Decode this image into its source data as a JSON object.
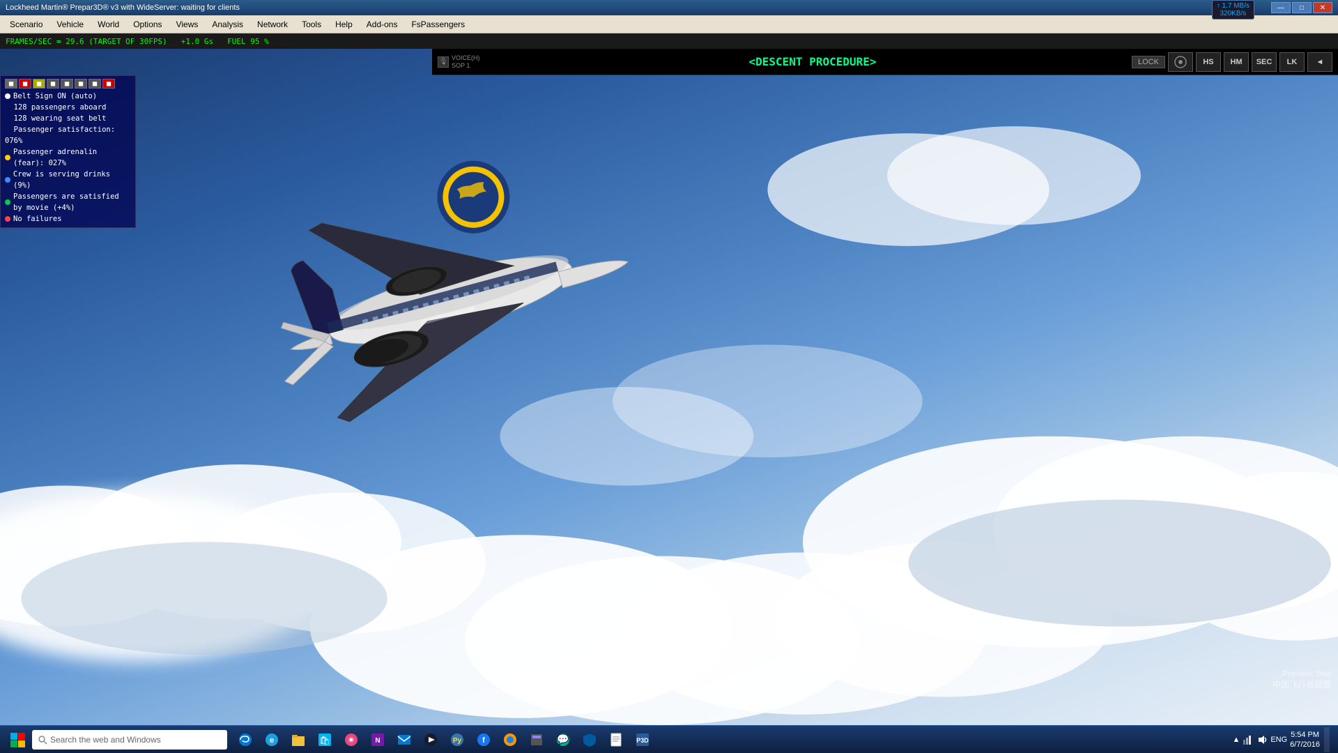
{
  "window": {
    "title": "Lockheed Martin® Prepar3D® v3 with WideServer: waiting for clients",
    "min_btn": "—",
    "max_btn": "□",
    "close_btn": "✕"
  },
  "network_speed": {
    "upload": "↑ 1.7 MB/s",
    "download": "320KB/s"
  },
  "menubar": {
    "items": [
      "Scenario",
      "Vehicle",
      "World",
      "Options",
      "Views",
      "Analysis",
      "Network",
      "Tools",
      "Help",
      "Add-ons",
      "FsPassengers"
    ]
  },
  "statusbar": {
    "fps": "FRAMES/SEC = 29.6  (TARGET OF 30FPS)",
    "gs": "+1.0 Gs",
    "fuel": "FUEL 95 %"
  },
  "atc": {
    "voice_label": "VOICE(H)\nSOP 1",
    "procedure": "<DESCENT PROCEDURE>",
    "lock_btn": "LOCK",
    "nav_btns": [
      "HS",
      "HM",
      "SEC",
      "LK",
      "◄"
    ]
  },
  "info_panel": {
    "icon_count": 8,
    "lines": [
      {
        "text": "Belt Sign ON (auto)",
        "dot": "white"
      },
      {
        "text": "128 passengers aboard",
        "dot": "none"
      },
      {
        "text": "128 wearing seat belt",
        "dot": "none"
      },
      {
        "text": "Passenger satisfaction: 076%",
        "dot": "none"
      },
      {
        "text": "Passenger adrenalin (fear): 027%",
        "dot": "yellow"
      },
      {
        "text": "Crew is serving drinks (9%)",
        "dot": "blue"
      },
      {
        "text": "Passengers are satisfied by movie (+4%)",
        "dot": "green"
      },
      {
        "text": "No failures",
        "dot": "red"
      }
    ]
  },
  "taskbar": {
    "search_placeholder": "Search the web and Windows",
    "apps": [
      "🪟",
      "🌐",
      "📁",
      "🏪",
      "🎵",
      "🌀",
      "📧",
      "🎬",
      "🐍",
      "🌍",
      "🦊",
      "📊",
      "💬",
      "🛡",
      "✈",
      "🎮"
    ],
    "tray": {
      "time": "5:54 PM",
      "date": "6/7/2016",
      "lang": "ENG"
    }
  },
  "watermark": {
    "line1": "Preview: free",
    "line2": "中国飞行者联盟"
  }
}
